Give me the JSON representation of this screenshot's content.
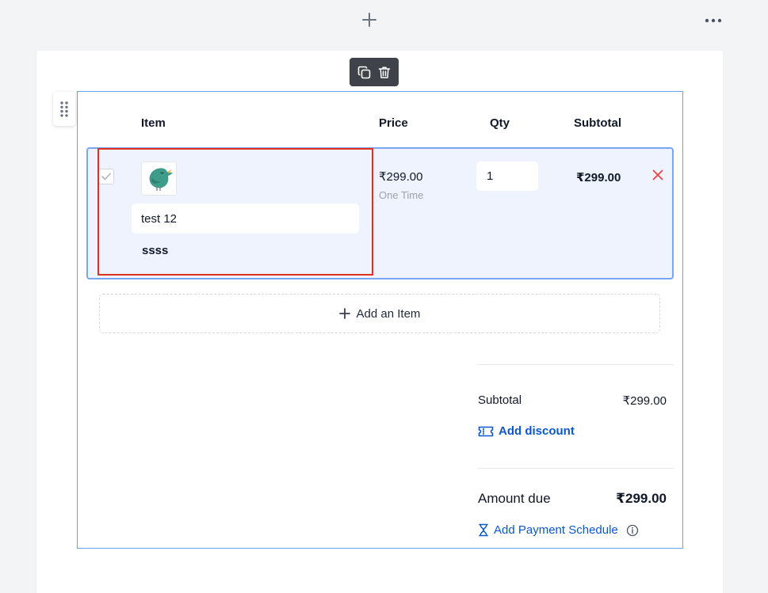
{
  "toolbar": {
    "add_icon": "plus-icon",
    "more_icon": "more-horizontal-icon",
    "copy_icon": "copy-icon",
    "delete_icon": "trash-icon"
  },
  "table": {
    "columns": {
      "item": "Item",
      "price": "Price",
      "qty": "Qty",
      "subtotal": "Subtotal"
    },
    "rows": [
      {
        "checked": true,
        "image_icon": "bird-image",
        "name": "test 12",
        "description": "ssss",
        "price": "₹299.00",
        "price_type": "One Time",
        "qty": "1",
        "subtotal": "₹299.00",
        "remove_icon": "close-icon"
      }
    ],
    "add_item_label": "Add an Item"
  },
  "summary": {
    "subtotal_label": "Subtotal",
    "subtotal_value": "₹299.00",
    "add_discount_label": "Add discount",
    "amount_due_label": "Amount due",
    "amount_due_value": "₹299.00",
    "add_payment_schedule_label": "Add Payment Schedule"
  },
  "colors": {
    "accent": "#0b57d0",
    "highlight": "#e0321f",
    "danger": "#ef4444",
    "row_bg": "#eef3fd",
    "row_border": "#7aa5f2"
  }
}
